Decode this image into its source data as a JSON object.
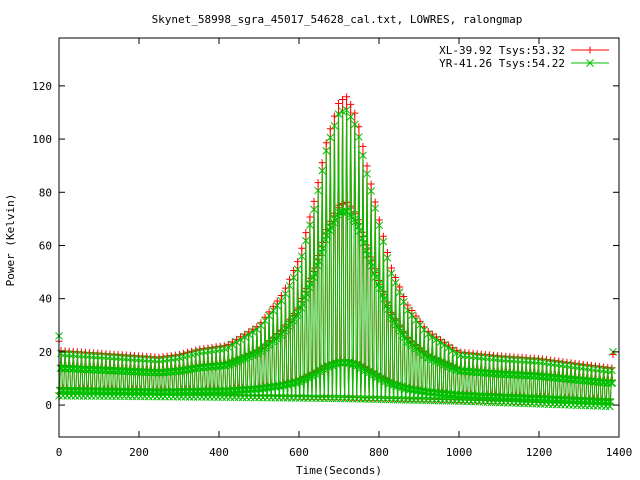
{
  "chart_data": {
    "type": "line",
    "title": "Skynet_58998_sgra_45017_54628_cal.txt, LOWRES, ralongmap",
    "xlabel": "Time(Seconds)",
    "ylabel": "Power (Kelvin)",
    "xlim": [
      0,
      1400
    ],
    "ylim": [
      -12,
      138
    ],
    "xticks": [
      0,
      200,
      400,
      600,
      800,
      1000,
      1200,
      1400
    ],
    "yticks": [
      0,
      20,
      40,
      60,
      80,
      100,
      120
    ],
    "xtick_labels": [
      "0",
      "200",
      "400",
      "600",
      "800",
      "1000",
      "1200",
      "1400"
    ],
    "ytick_labels": [
      "0",
      "20",
      "40",
      "60",
      "80",
      "100",
      "120"
    ],
    "grid": false,
    "legend_position": "top-right",
    "scan_period_seconds": 10.2,
    "scan_start_seconds": 0,
    "scan_end_seconds": 1385,
    "series": [
      {
        "name": "XL-39.92 Tsys:53.32",
        "color": "#ff0000",
        "marker": "plus",
        "baseline": [
          [
            0,
            4.5
          ],
          [
            400,
            4
          ],
          [
            700,
            3
          ],
          [
            1000,
            2
          ],
          [
            1380,
            0.5
          ]
        ],
        "envelope": [
          [
            0,
            20.5
          ],
          [
            100,
            19.5
          ],
          [
            250,
            18
          ],
          [
            300,
            19
          ],
          [
            350,
            21
          ],
          [
            420,
            22.5
          ],
          [
            500,
            30
          ],
          [
            560,
            42
          ],
          [
            600,
            55
          ],
          [
            640,
            78
          ],
          [
            670,
            100
          ],
          [
            700,
            114
          ],
          [
            720,
            116
          ],
          [
            745,
            108
          ],
          [
            770,
            90
          ],
          [
            800,
            70
          ],
          [
            830,
            52
          ],
          [
            870,
            38
          ],
          [
            920,
            28
          ],
          [
            1000,
            20
          ],
          [
            1100,
            18.5
          ],
          [
            1200,
            17.5
          ],
          [
            1300,
            15.5
          ],
          [
            1380,
            14
          ]
        ]
      },
      {
        "name": "YR-41.26 Tsys:54.22",
        "color": "#00c000",
        "marker": "cross",
        "baseline": [
          [
            0,
            3.5
          ],
          [
            400,
            3
          ],
          [
            700,
            2.5
          ],
          [
            1000,
            1.5
          ],
          [
            1380,
            -0.5
          ]
        ],
        "envelope": [
          [
            0,
            19.5
          ],
          [
            100,
            18.5
          ],
          [
            250,
            17
          ],
          [
            300,
            18
          ],
          [
            350,
            20
          ],
          [
            420,
            21.5
          ],
          [
            500,
            29
          ],
          [
            560,
            40
          ],
          [
            600,
            52
          ],
          [
            640,
            75
          ],
          [
            670,
            97
          ],
          [
            700,
            110
          ],
          [
            720,
            111
          ],
          [
            745,
            104
          ],
          [
            770,
            87
          ],
          [
            800,
            68
          ],
          [
            830,
            50
          ],
          [
            870,
            36
          ],
          [
            920,
            27
          ],
          [
            1000,
            19
          ],
          [
            1100,
            17.5
          ],
          [
            1200,
            16.5
          ],
          [
            1300,
            14.5
          ],
          [
            1380,
            13
          ]
        ]
      }
    ],
    "edge_points": [
      {
        "x": 0,
        "y": 26,
        "series": 1
      },
      {
        "x": 0,
        "y": 24,
        "series": 0
      },
      {
        "x": 1385,
        "y": 20,
        "series": 1
      },
      {
        "x": 1385,
        "y": 19,
        "series": 0
      }
    ]
  }
}
